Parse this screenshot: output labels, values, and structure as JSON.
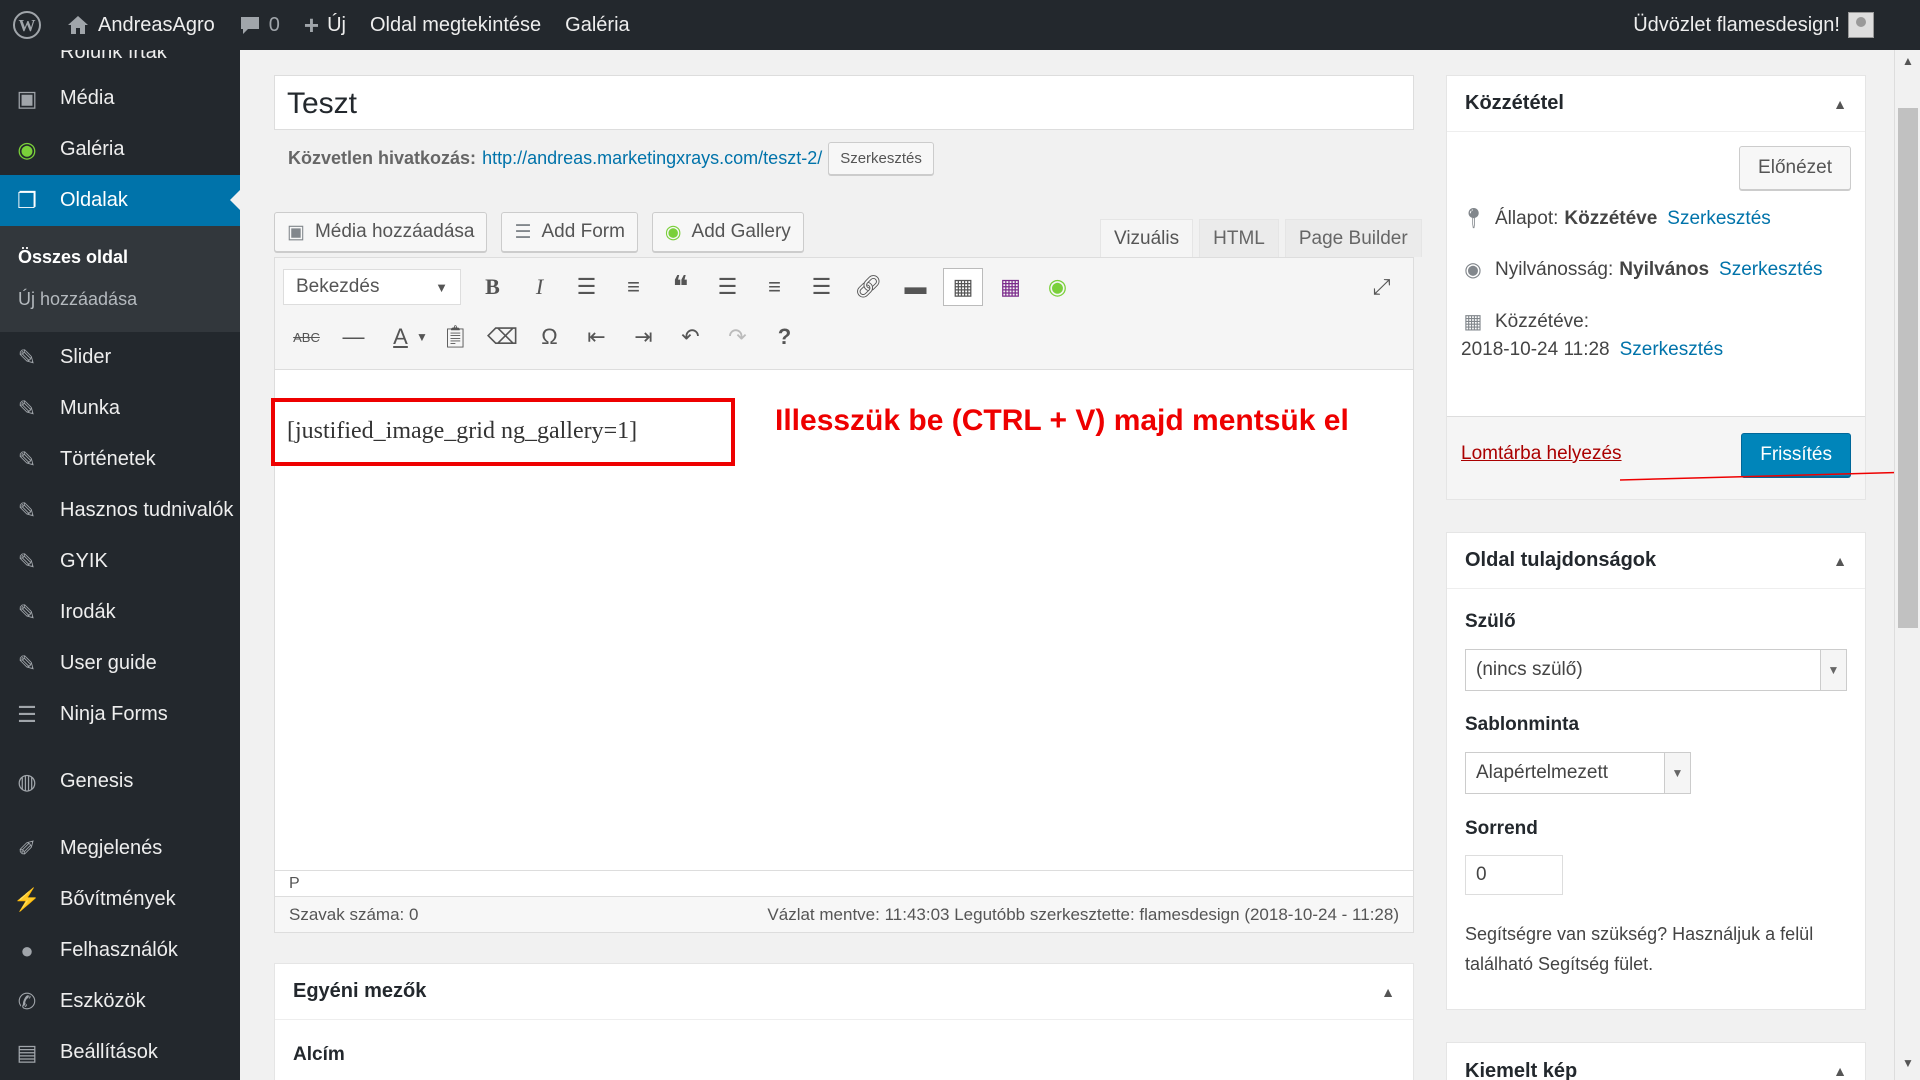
{
  "adminbar": {
    "site_name": "AndreasAgro",
    "comments_count": "0",
    "new_label": "Új",
    "view_page": "Oldal megtekintése",
    "gallery": "Galéria",
    "greeting": "Üdvözlet flamesdesign!"
  },
  "sidebar": {
    "items": [
      {
        "label": "Rólunk írták",
        "icon": "quote-icon"
      },
      {
        "label": "Média",
        "icon": "media-icon"
      },
      {
        "label": "Galéria",
        "icon": "gallery-icon"
      },
      {
        "label": "Oldalak",
        "icon": "pages-icon"
      },
      {
        "label": "Slider",
        "icon": "pin-icon"
      },
      {
        "label": "Munka",
        "icon": "pin-icon"
      },
      {
        "label": "Történetek",
        "icon": "pin-icon"
      },
      {
        "label": "Hasznos tudnivalók",
        "icon": "pin-icon"
      },
      {
        "label": "GYIK",
        "icon": "pin-icon"
      },
      {
        "label": "Irodák",
        "icon": "pin-icon"
      },
      {
        "label": "User guide",
        "icon": "pin-icon"
      },
      {
        "label": "Ninja Forms",
        "icon": "forms-icon"
      },
      {
        "label": "Genesis",
        "icon": "genesis-icon"
      },
      {
        "label": "Megjelenés",
        "icon": "brush-icon"
      },
      {
        "label": "Bővítmények",
        "icon": "plugin-icon"
      },
      {
        "label": "Felhasználók",
        "icon": "users-icon"
      },
      {
        "label": "Eszközök",
        "icon": "wrench-icon"
      },
      {
        "label": "Beállítások",
        "icon": "settings-icon"
      }
    ],
    "submenu": {
      "all_pages": "Összes oldal",
      "add_new": "Új hozzáadása"
    }
  },
  "editor": {
    "title": "Teszt",
    "permalink_label": "Közvetlen hivatkozás:",
    "permalink_url": "http://andreas.marketingxrays.com/teszt-2/",
    "permalink_edit": "Szerkesztés",
    "media_buttons": {
      "add_media": "Média hozzáadása",
      "add_form": "Add Form",
      "add_gallery": "Add Gallery"
    },
    "tabs": {
      "visual": "Vizuális",
      "html": "HTML",
      "page_builder": "Page Builder"
    },
    "format_select": "Bekezdés",
    "content": "[justified_image_grid ng_gallery=1]",
    "annotation": "Illesszük be (CTRL + V) majd mentsük el",
    "path": "P",
    "word_count": "Szavak száma: 0",
    "draft_status": "Vázlat mentve: 11:43:03 Legutóbb szerkesztette: flamesdesign (2018-10-24 - 11:28)"
  },
  "custom_fields": {
    "heading": "Egyéni mezők",
    "subtitle_label": "Alcím"
  },
  "publish": {
    "heading": "Közzététel",
    "preview": "Előnézet",
    "status_label": "Állapot:",
    "status_value": "Közzétéve",
    "visibility_label": "Nyilvánosság:",
    "visibility_value": "Nyilvános",
    "published_label": "Közzétéve:",
    "published_date": "2018-10-24 11:28",
    "edit": "Szerkesztés",
    "trash": "Lomtárba helyezés",
    "update": "Frissítés"
  },
  "page_attributes": {
    "heading": "Oldal tulajdonságok",
    "parent_label": "Szülő",
    "parent_value": "(nincs szülő)",
    "template_label": "Sablonminta",
    "template_value": "Alapértelmezett",
    "order_label": "Sorrend",
    "order_value": "0",
    "help": "Segítségre van szükség? Használjuk a felül található Segítség fület."
  },
  "featured_image": {
    "heading": "Kiemelt kép"
  },
  "colors": {
    "accent": "#0073aa",
    "annotation": "#e00000",
    "admin_dark": "#23282d"
  }
}
